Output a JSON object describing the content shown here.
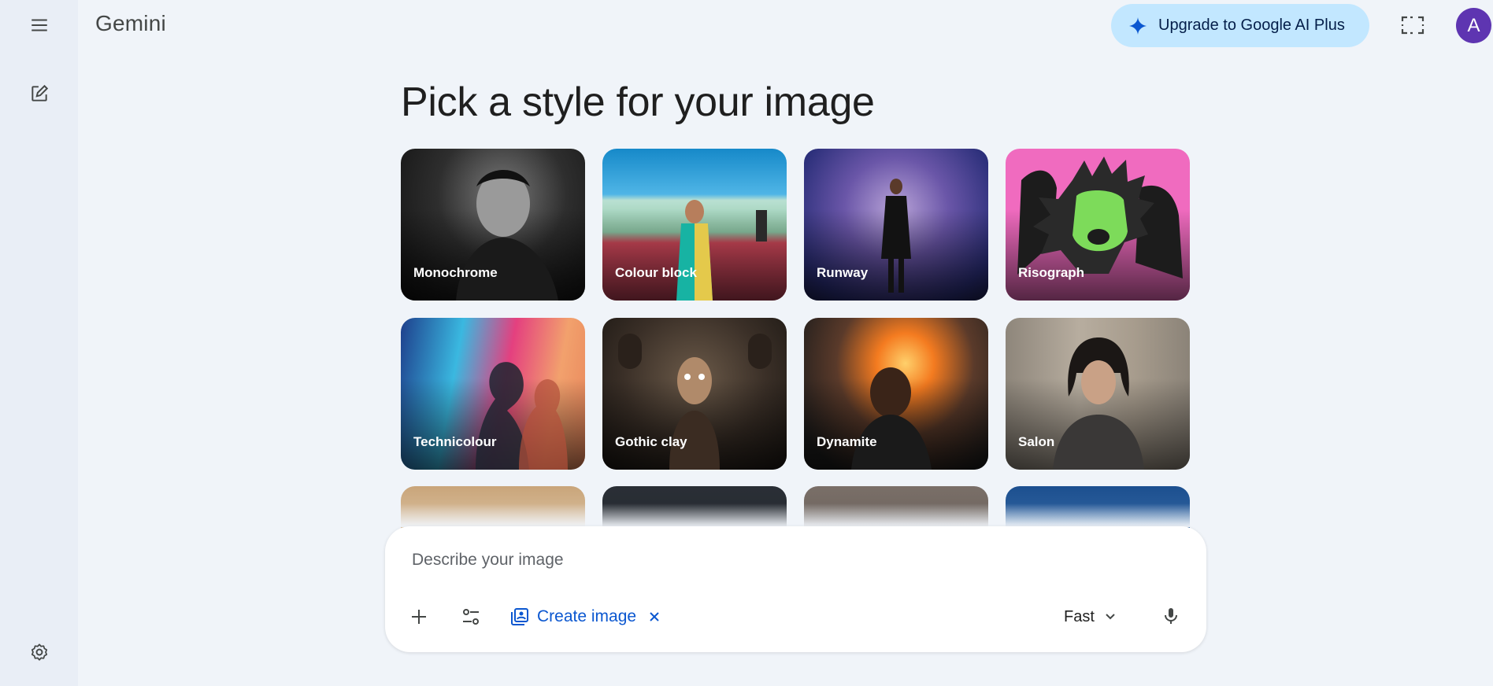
{
  "app": {
    "title": "Gemini"
  },
  "rail": {
    "menu_icon": "hamburger-menu-icon",
    "new_chat_icon": "edit-icon",
    "settings_icon": "gear-icon"
  },
  "header": {
    "upgrade_label": "Upgrade to Google AI Plus",
    "upgrade_icon": "sparkle-icon",
    "screen_icon": "screen-capture-icon",
    "avatar_initial": "A",
    "avatar_color": "#5e35b1"
  },
  "main": {
    "heading": "Pick a style for your image",
    "styles": [
      {
        "label": "Monochrome"
      },
      {
        "label": "Colour block"
      },
      {
        "label": "Runway"
      },
      {
        "label": "Risograph"
      },
      {
        "label": "Technicolour"
      },
      {
        "label": "Gothic clay"
      },
      {
        "label": "Dynamite"
      },
      {
        "label": "Salon"
      }
    ]
  },
  "prompt": {
    "placeholder": "Describe your image",
    "create_image_label": "Create image",
    "model_label": "Fast"
  },
  "colors": {
    "accent": "#0b57d0",
    "upgrade_bg": "#c2e7ff",
    "page_bg": "#f0f4f9"
  }
}
